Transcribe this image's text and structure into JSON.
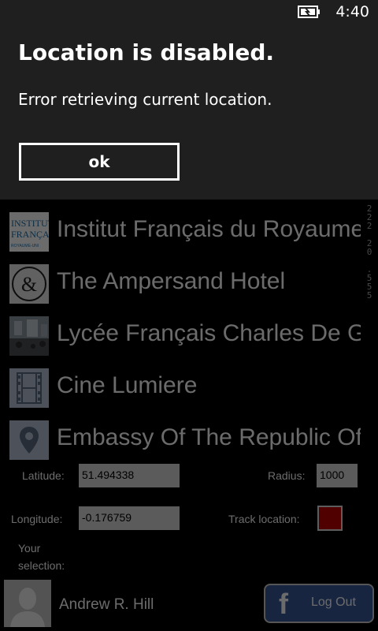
{
  "status_bar": {
    "time": "4:40",
    "battery_icon": "battery-charging-icon"
  },
  "dialog": {
    "title": "Location is disabled.",
    "message": "Error retrieving current location.",
    "ok_label": "ok"
  },
  "places": [
    {
      "name": "Institut Français du Royaume-Uni",
      "icon": "institut-logo-thumbnail"
    },
    {
      "name": "The Ampersand Hotel",
      "icon": "ampersand-icon"
    },
    {
      "name": "Lycée Français Charles De Gaulle",
      "icon": "lycee-photo-thumbnail"
    },
    {
      "name": "Cine Lumiere",
      "icon": "film-strip-icon"
    },
    {
      "name": "Embassy Of The Republic Of",
      "icon": "map-pin-icon"
    }
  ],
  "institut_logo": {
    "line1": "INSTITUT",
    "line2": "FRANÇAIS",
    "line3": "ROYAUME-UNI"
  },
  "scroll_readout": "222 20 .555",
  "form": {
    "latitude_label": "Latitude:",
    "latitude_value": "51.494338",
    "radius_label": "Radius:",
    "radius_value": "1000",
    "longitude_label": "Longitude:",
    "longitude_value": "-0.176759",
    "track_location_label": "Track location:",
    "track_location_checked": true,
    "selection_label_line1": "Your",
    "selection_label_line2": "selection:"
  },
  "user": {
    "name": "Andrew R. Hill",
    "avatar_icon": "avatar-placeholder-icon"
  },
  "facebook": {
    "logo_glyph": "f",
    "button_label": "Log Out"
  },
  "colors": {
    "dialog_bg": "#1f1f1f",
    "checkbox_fill": "#c00000",
    "facebook_blue": "#3b5998"
  }
}
